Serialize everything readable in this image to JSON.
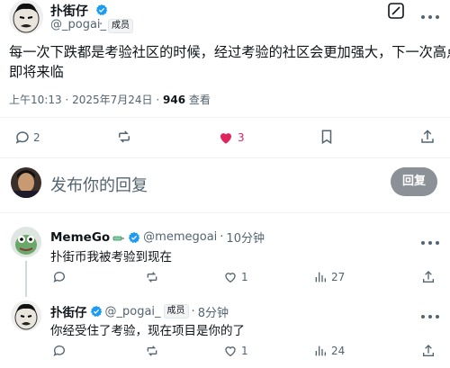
{
  "main_post": {
    "author_name": "扑街仔",
    "author_handle": "@_pogai_",
    "handle_dot": "·",
    "member_badge": "成员",
    "text_line1": "每一次下跌都是考验社区的时候，经过考验的社区会更加强大，下一次高点",
    "text_line2": "即将来临",
    "time": "上午10:13",
    "date": "2025年7月24日",
    "meta_dot": "·",
    "views_count": "946",
    "views_label": "查看",
    "replies_count": "2",
    "likes_count": "3",
    "like_color": "#e0245e"
  },
  "compose": {
    "placeholder": "发布你的回复",
    "reply_button": "回复"
  },
  "replies": [
    {
      "author_name": "MemeGo",
      "author_handle": "@memegoai",
      "time": "10分钟",
      "dot": "·",
      "text": "扑街币我被考验到现在",
      "likes_count": "1",
      "views_count": "27"
    },
    {
      "author_name": "扑街仔",
      "author_handle": "@_pogai_",
      "member_badge": "成员",
      "time": "8分钟",
      "dot": "·",
      "text": "你经受住了考验，现在项目是你的了",
      "likes_count": "1",
      "views_count": "24"
    }
  ],
  "colors": {
    "verified": "#1d9bf0",
    "text": "#0f1419",
    "secondary": "#536471"
  }
}
